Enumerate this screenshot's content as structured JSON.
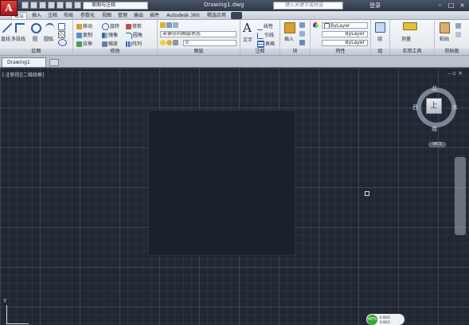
{
  "app": {
    "logo": "A",
    "workspace": "草图与注释",
    "doc_title": "Drawing1.dwg",
    "search_placeholder": "键入关键字或短语",
    "login": "登录"
  },
  "ribbon_tabs": [
    "默认",
    "插入",
    "注释",
    "布局",
    "参数化",
    "视图",
    "管理",
    "输出",
    "插件",
    "Autodesk 360",
    "精选应用"
  ],
  "draw": {
    "line": "直线",
    "polyline": "多段线",
    "circle": "圆",
    "arc": "圆弧",
    "title": "绘图"
  },
  "modify": {
    "move": "移动",
    "rotate": "旋转",
    "trim": "修剪",
    "copy": "复制",
    "mirror": "镜像",
    "fillet": "圆角",
    "stretch": "拉伸",
    "scale": "缩放",
    "array": "阵列",
    "title": "修改"
  },
  "layers": {
    "state": "未保存的图层状态",
    "layer": "0",
    "title": "图层"
  },
  "annotation": {
    "text": "文字",
    "linear": "线性",
    "leader": "引线",
    "table": "表格",
    "title": "注释"
  },
  "block": {
    "insert": "插入",
    "title": "块"
  },
  "properties": {
    "color": "ByLayer",
    "linetype": "ByLayer",
    "lineweight": "ByLayer",
    "title": "特性"
  },
  "groups": {
    "group": "组",
    "title": "组"
  },
  "utilities": {
    "measure": "测量",
    "title": "实用工具"
  },
  "clipboard": {
    "paste": "粘贴",
    "title": "剪贴板"
  },
  "file_tab": "Drawing1",
  "viewport": {
    "label": "[-][俯视][二维线框]"
  },
  "viewcube": {
    "face": "上",
    "north": "北",
    "south": "南",
    "east": "东",
    "west": "西",
    "wcs": "WCS"
  },
  "ucs": {
    "y": "Y"
  },
  "perf": {
    "percent": "40%",
    "line1": "0.0K/S",
    "line2": "0.0K/S"
  }
}
